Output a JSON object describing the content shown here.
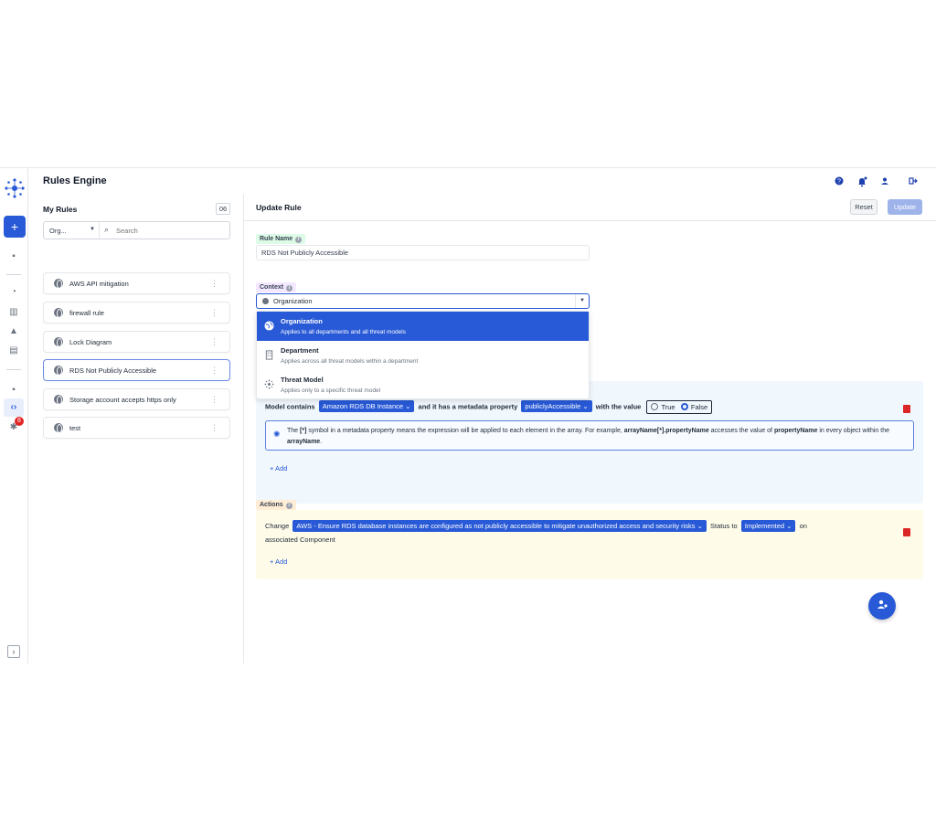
{
  "header": {
    "title": "Rules Engine"
  },
  "sidebar": {
    "count_label": "06",
    "title": "My Rules",
    "filter": {
      "org_label": "Org...",
      "search_placeholder": "Search"
    },
    "rules": [
      {
        "label": "AWS API mitigation"
      },
      {
        "label": "firewall rule"
      },
      {
        "label": "Lock Diagram"
      },
      {
        "label": "RDS Not Publicly Accessible",
        "selected": true
      },
      {
        "label": "Storage account accepts https only"
      },
      {
        "label": "test"
      }
    ],
    "notification_badge": "8"
  },
  "main": {
    "title": "Update Rule",
    "reset_label": "Reset",
    "update_label": "Update",
    "rule_name_label": "Rule Name",
    "rule_name_value": "RDS Not Publicly Accessible",
    "context_label": "Context",
    "context_value": "Organization",
    "context_options": [
      {
        "title": "Organization",
        "desc": "Applies to all departments and all threat models",
        "selected": true
      },
      {
        "title": "Department",
        "desc": "Applies across all threat models within a department"
      },
      {
        "title": "Threat Model",
        "desc": "Applies only to a specific threat model"
      }
    ],
    "condition": {
      "prefix": "Model contains",
      "component": "Amazon RDS DB Instance",
      "mid": "and it has a metadata property",
      "property": "publiclyAccessible",
      "suffix": "with the value",
      "true_label": "True",
      "false_label": "False",
      "info_1": "The ",
      "info_2": "[*]",
      "info_3": " symbol in a metadata property means the expression will be applied to each element in the array. For example, ",
      "info_4": "arrayName[*].propertyName",
      "info_5": " accesses the value of ",
      "info_6": "propertyName",
      "info_7": " in every object within the ",
      "info_8": "arrayName",
      "info_9": ".",
      "add_label": "+ Add"
    },
    "actions": {
      "label": "Actions",
      "prefix": "Change",
      "countermeasure": "AWS - Ensure RDS database instances are configured as not publicly accessible to mitigate unauthorized access and security risks",
      "mid": "Status to",
      "status": "Implemented",
      "suffix": "on",
      "line2": "associated Component",
      "add_label": "+ Add"
    }
  },
  "colors": {
    "accent": "#2859d6",
    "danger": "#dc2626",
    "update_disabled": "#9db3ea"
  }
}
